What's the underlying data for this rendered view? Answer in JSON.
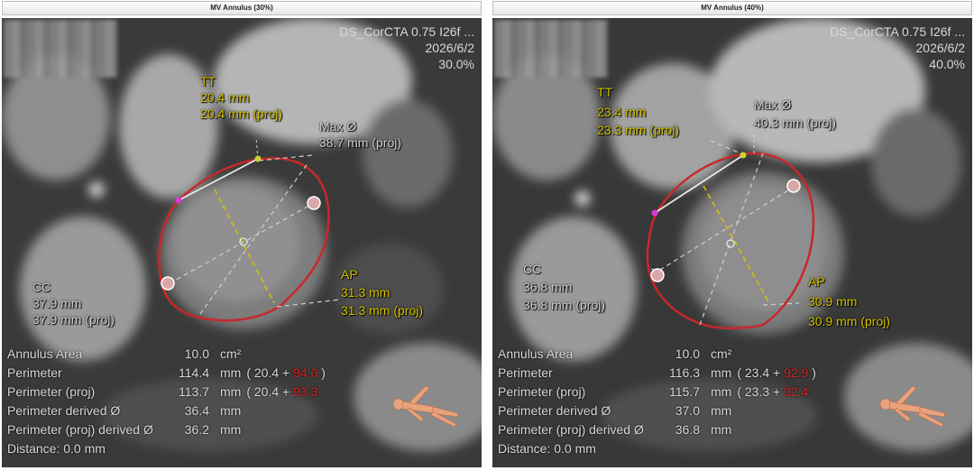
{
  "panels": [
    {
      "title": "MV Annulus  (30%)",
      "series": "DS_CorCTA  0.75  I26f  ...",
      "date": "2026/6/2",
      "phase": "30.0%",
      "tt_label": "TT",
      "tt_value": "20.4 mm",
      "tt_proj": "20.4 mm (proj)",
      "max_label": "Max Ø",
      "max_proj": "38.7 mm (proj)",
      "cc_label": "CC",
      "cc_value": "37.9 mm",
      "cc_proj": "37.9 mm (proj)",
      "ap_label": "AP",
      "ap_value": "31.3 mm",
      "ap_proj": "31.3 mm (proj)",
      "rows": {
        "area": {
          "label": "Annulus Area",
          "value": "10.0",
          "unit": "cm²"
        },
        "perimeter": {
          "label": "Perimeter",
          "value": "114.4",
          "unit": "mm",
          "a": "20.4",
          "b": "94.0"
        },
        "perimeter_proj": {
          "label": "Perimeter (proj)",
          "value": "113.7",
          "unit": "mm",
          "a": "20.4",
          "b": "93.3"
        },
        "derived": {
          "label": "Perimeter derived Ø",
          "value": "36.4",
          "unit": "mm"
        },
        "derived_proj": {
          "label": "Perimeter (proj) derived Ø",
          "value": "36.2",
          "unit": "mm"
        },
        "distance": {
          "label": "Distance: 0.0 mm"
        }
      }
    },
    {
      "title": "MV Annulus  (40%)",
      "series": "DS_CorCTA  0.75  I26f  ...",
      "date": "2026/6/2",
      "phase": "40.0%",
      "tt_label": "TT",
      "tt_value": "23.4 mm",
      "tt_proj": "23.3 mm (proj)",
      "max_label": "Max Ø",
      "max_proj": "40.3 mm (proj)",
      "cc_label": "CC",
      "cc_value": "36.8 mm",
      "cc_proj": "36.8 mm (proj)",
      "ap_label": "AP",
      "ap_value": "30.9 mm",
      "ap_proj": "30.9 mm (proj)",
      "rows": {
        "area": {
          "label": "Annulus Area",
          "value": "10.0",
          "unit": "cm²"
        },
        "perimeter": {
          "label": "Perimeter",
          "value": "116.3",
          "unit": "mm",
          "a": "23.4",
          "b": "92.9"
        },
        "perimeter_proj": {
          "label": "Perimeter (proj)",
          "value": "115.7",
          "unit": "mm",
          "a": "23.3",
          "b": "92.4"
        },
        "derived": {
          "label": "Perimeter derived Ø",
          "value": "37.0",
          "unit": "mm"
        },
        "derived_proj": {
          "label": "Perimeter (proj) derived Ø",
          "value": "36.8",
          "unit": "mm"
        },
        "distance": {
          "label": "Distance: 0.0 mm"
        }
      }
    }
  ],
  "symbols": {
    "open_paren": "(",
    "close_paren": ")",
    "plus": "+"
  },
  "colors": {
    "annulus_outline": "#c8282a",
    "tt_line": "#e8e8e8",
    "ap_line": "#d6c200",
    "diameter_lines": "#cfcfcf",
    "annotation_yellow": "#d6c200",
    "highlight_red": "#e02020"
  },
  "icons": {
    "orientation": "patient-orientation-body-icon"
  }
}
